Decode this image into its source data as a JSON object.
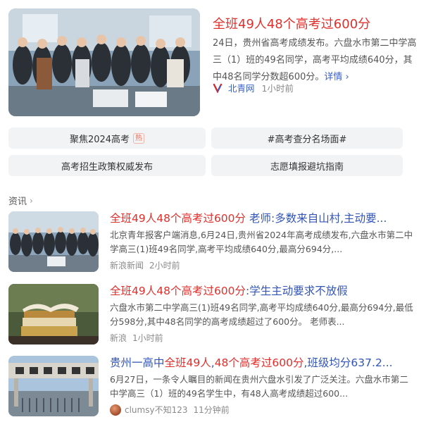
{
  "top_card": {
    "title": "全班49人48个高考过600分",
    "desc": "24日，贵州省高考成绩发布。六盘水市第二中学高三（1）班的49名同学，高考平均成绩640分，其中48名同学分数超600分。",
    "more": "详情",
    "source": "北青网",
    "time": "1小时前"
  },
  "chips": {
    "c1": "聚焦2024高考",
    "c1_badge": "热",
    "c2": "#高考查分名场面#",
    "c3": "高考招生政策权威发布",
    "c4": "志愿填报避坑指南"
  },
  "section": {
    "label": "资讯"
  },
  "news": [
    {
      "title_hl": "全班49人48个高考过600分",
      "title_rest": " 老师:多数来自山村,主动要...",
      "desc": "北京青年报客户端消息,6月24日,贵州省2024年高考成绩发布,六盘水市第二中学高三(1)班49名同学,高考平均成绩640分,最高分694分,...",
      "source": "新浪新闻",
      "time": "2小时前"
    },
    {
      "title_hl": "全班49人48个高考过600分",
      "title_rest": ":学生主动要求不放假",
      "desc": "六盘水市第二中学高三(1)班49名同学,高考平均成绩640分,最高分694分,最低分598分,其中48名同学的高考成绩超过了600分。 老师表...",
      "source": "新浪",
      "time": "1小时前"
    },
    {
      "title_pre": "贵州一高中",
      "title_hl": "全班49人",
      "title_mid": ",",
      "title_hl2": "48个高考过600分",
      "title_rest": ",班级均分637.2...",
      "desc": "6月27日，一条令人瞩目的新闻在贵州六盘水引发了广泛关注。六盘水市第二中学高三（1）班的49名学生中，有48人高考成绩超过600...",
      "source": "clumsy不知123",
      "time": "11分钟前"
    }
  ]
}
